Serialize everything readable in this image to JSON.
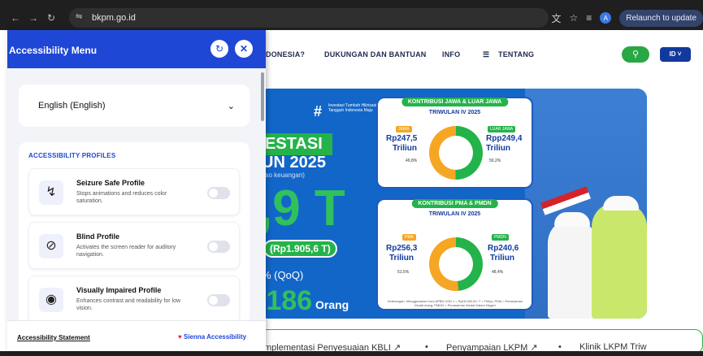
{
  "browser": {
    "back_icon": "arrow-left-icon",
    "forward_icon": "arrow-right-icon",
    "reload_icon": "reload-icon",
    "url": "bkpm.go.id",
    "avatar_letter": "A",
    "relaunch_label": "Relaunch to update"
  },
  "site_nav": {
    "items": [
      "DONESIA?",
      "DUKUNGAN DAN BANTUAN",
      "INFO",
      "TENTANG"
    ],
    "lang_button": "ID ˅"
  },
  "banner": {
    "hash_text": "Investasi Tumbuh Hilirisasi Tangguh Indonesia Maju",
    "title_fragment": "ESTASI",
    "year_fragment": "UN 2025",
    "sub_fragment": "aso keuangan)",
    "big_value": ",9 T",
    "pill_value": "(Rp1.905,6 T)",
    "qoq": "% (QoQ)",
    "jobs_value": ".186",
    "jobs_unit": "Orang",
    "card1": {
      "title": "KONTRIBUSI JAWA & LUAR JAWA",
      "subtitle": "TRIWULAN IV 2025",
      "left_tag": "JAWA",
      "left_value": "Rp247,5",
      "left_unit": "Triliun",
      "left_pct": "49,8%",
      "right_tag": "LUAR JAWA",
      "right_value": "Rpp249,4",
      "right_unit": "Triliun",
      "right_pct": "50,2%"
    },
    "card2": {
      "title": "KONTRIBUSI PMA & PMDN",
      "subtitle": "TRIWULAN IV 2025",
      "left_tag": "PMA",
      "left_value": "Rp256,3",
      "left_unit": "Triliun",
      "left_pct": "51,5%",
      "right_tag": "PMDN",
      "right_value": "Rp240,6",
      "right_unit": "Triliun",
      "right_pct": "48,4%",
      "footnote": "Keterangan: Menggunakan Kurs APBN USD 1 = Rp16.000,00; T = Triliun; PMA = Penanaman Modal Asing; PMDN = Penanaman Modal Dalam Negeri"
    }
  },
  "quick_links": [
    "mplementasi Penyesuaian KBLI ↗",
    "•",
    "Penyampaian LKPM ↗",
    "•",
    "Klinik LKPM Triw"
  ],
  "accessibility": {
    "title": "Accessibility Menu",
    "language": "English (English)",
    "profiles_heading": "ACCESSIBILITY PROFILES",
    "profiles": [
      {
        "name": "Seizure Safe Profile",
        "desc": "Stops animations and reduces color saturation.",
        "icon": "no-flash-icon"
      },
      {
        "name": "Blind Profile",
        "desc": "Activates the screen reader for auditory navigation.",
        "icon": "eye-off-icon"
      },
      {
        "name": "Visually Impaired Profile",
        "desc": "Enhances contrast and readability for low vision.",
        "icon": "eye-icon"
      }
    ],
    "statement": "Accessibility Statement",
    "brand": "Sienna Accessibility"
  },
  "colors": {
    "accent": "#1f47d6",
    "brand_green": "#24b34a",
    "banner_blue": "#1266c8"
  }
}
